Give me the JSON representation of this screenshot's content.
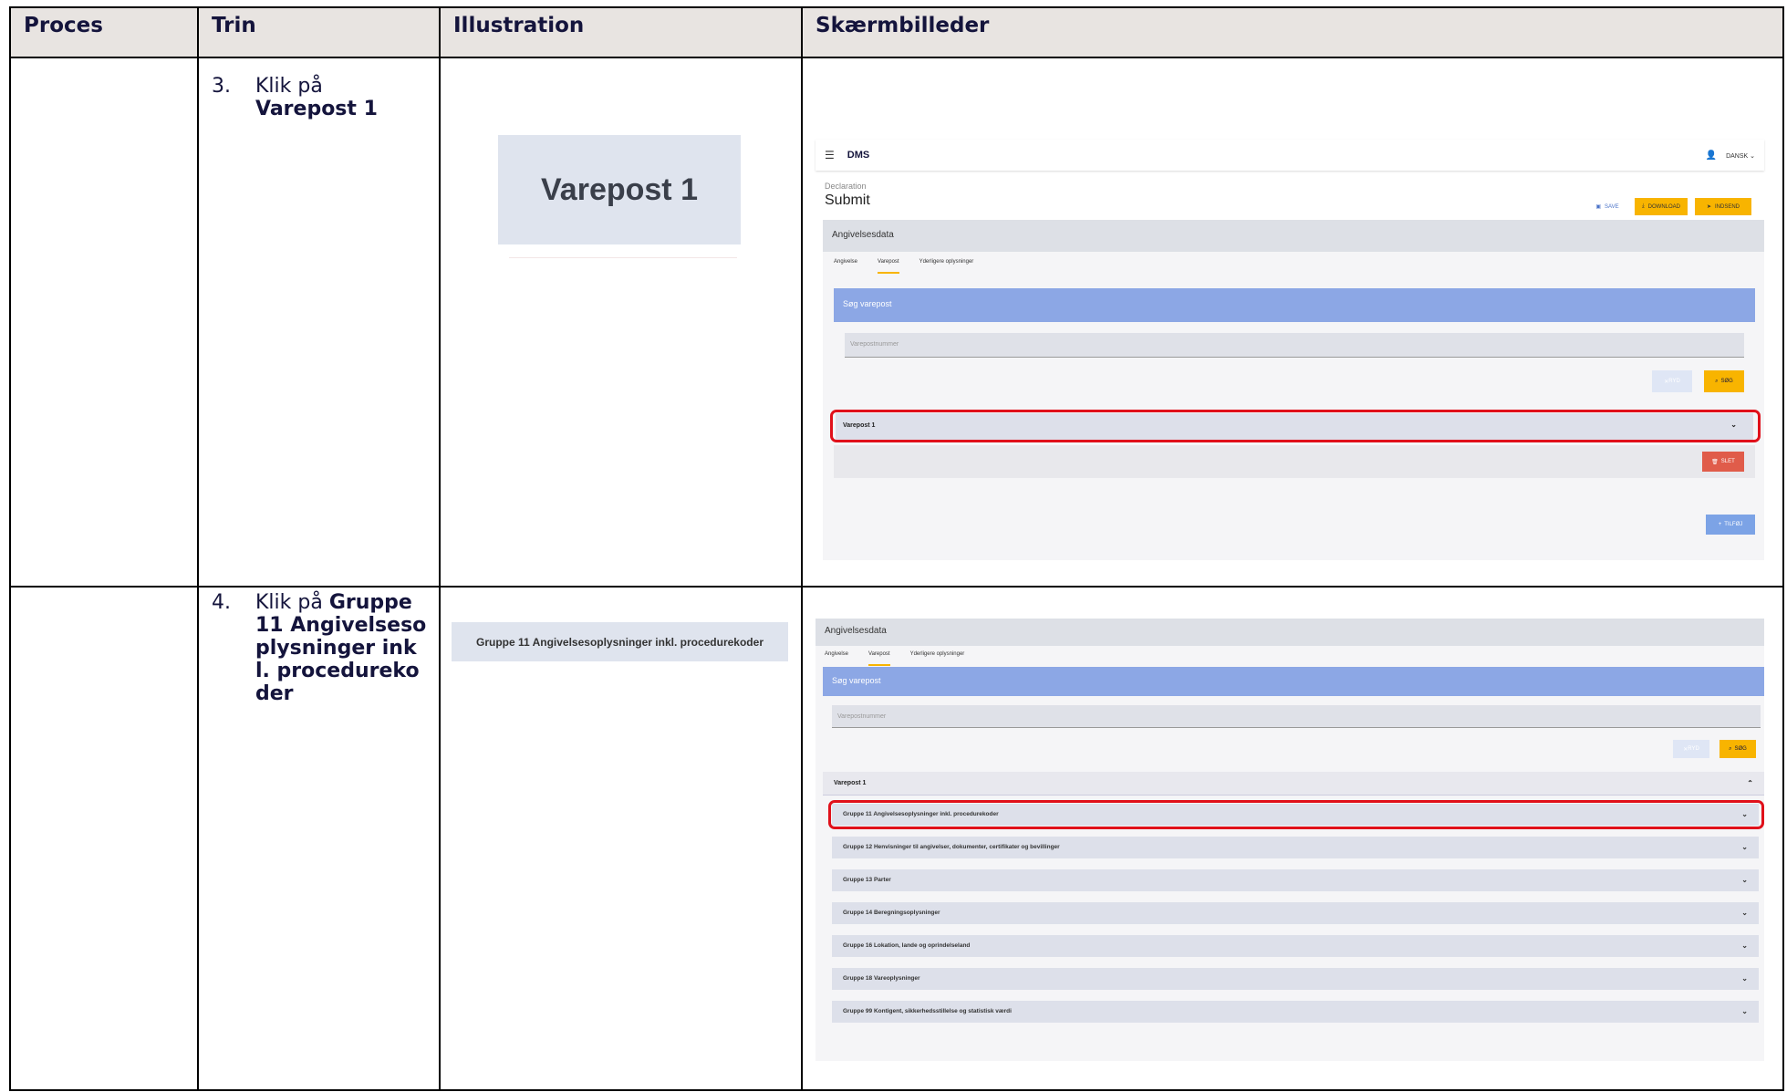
{
  "table": {
    "headers": [
      "Proces",
      "Trin",
      "Illustration",
      "Skærmbilleder"
    ]
  },
  "rows": [
    {
      "step_num": "3.",
      "step_text": "Klik på ",
      "step_bold": "Varepost 1",
      "illustration": "Varepost 1"
    },
    {
      "step_num": "4.",
      "step_text": "Klik på ",
      "step_bold": "Gruppe 11 Angivelsesoplysninger inkl. procedurekoder",
      "illustration": "Gruppe 11 Angivelsesoplysninger inkl. procedurekoder"
    }
  ],
  "app": {
    "brand": "DMS",
    "language": "DANSK",
    "breadcrumb": "Declaration",
    "title": "Submit",
    "save": "SAVE",
    "download": "DOWNLOAD",
    "send": "INDSEND",
    "section": "Angivelsesdata",
    "tabs": [
      "Angivelse",
      "Varepost",
      "Yderligere oplysninger"
    ],
    "search_title": "Søg varepost",
    "search_placeholder": "Varepostnummer",
    "clear": "RYD",
    "search": "SØG",
    "varepost": "Varepost 1",
    "delete": "SLET",
    "add": "TILFØJ",
    "groups": [
      "Gruppe 11 Angivelsesoplysninger inkl. procedurekoder",
      "Gruppe 12 Henvisninger til angivelser, dokumenter, certifikater og bevillinger",
      "Gruppe 13 Parter",
      "Gruppe 14 Beregningsoplysninger",
      "Gruppe 16 Lokation, lande og oprindelseland",
      "Gruppe 18 Vareoplysninger",
      "Gruppe 99 Kontigent, sikkerhedsstillelse og statistisk værdi"
    ]
  },
  "colors": {
    "highlight": "#e0101a",
    "accent": "#f8b400",
    "header_bg": "#e8e4e1",
    "search_bar": "#8ca7e5"
  }
}
